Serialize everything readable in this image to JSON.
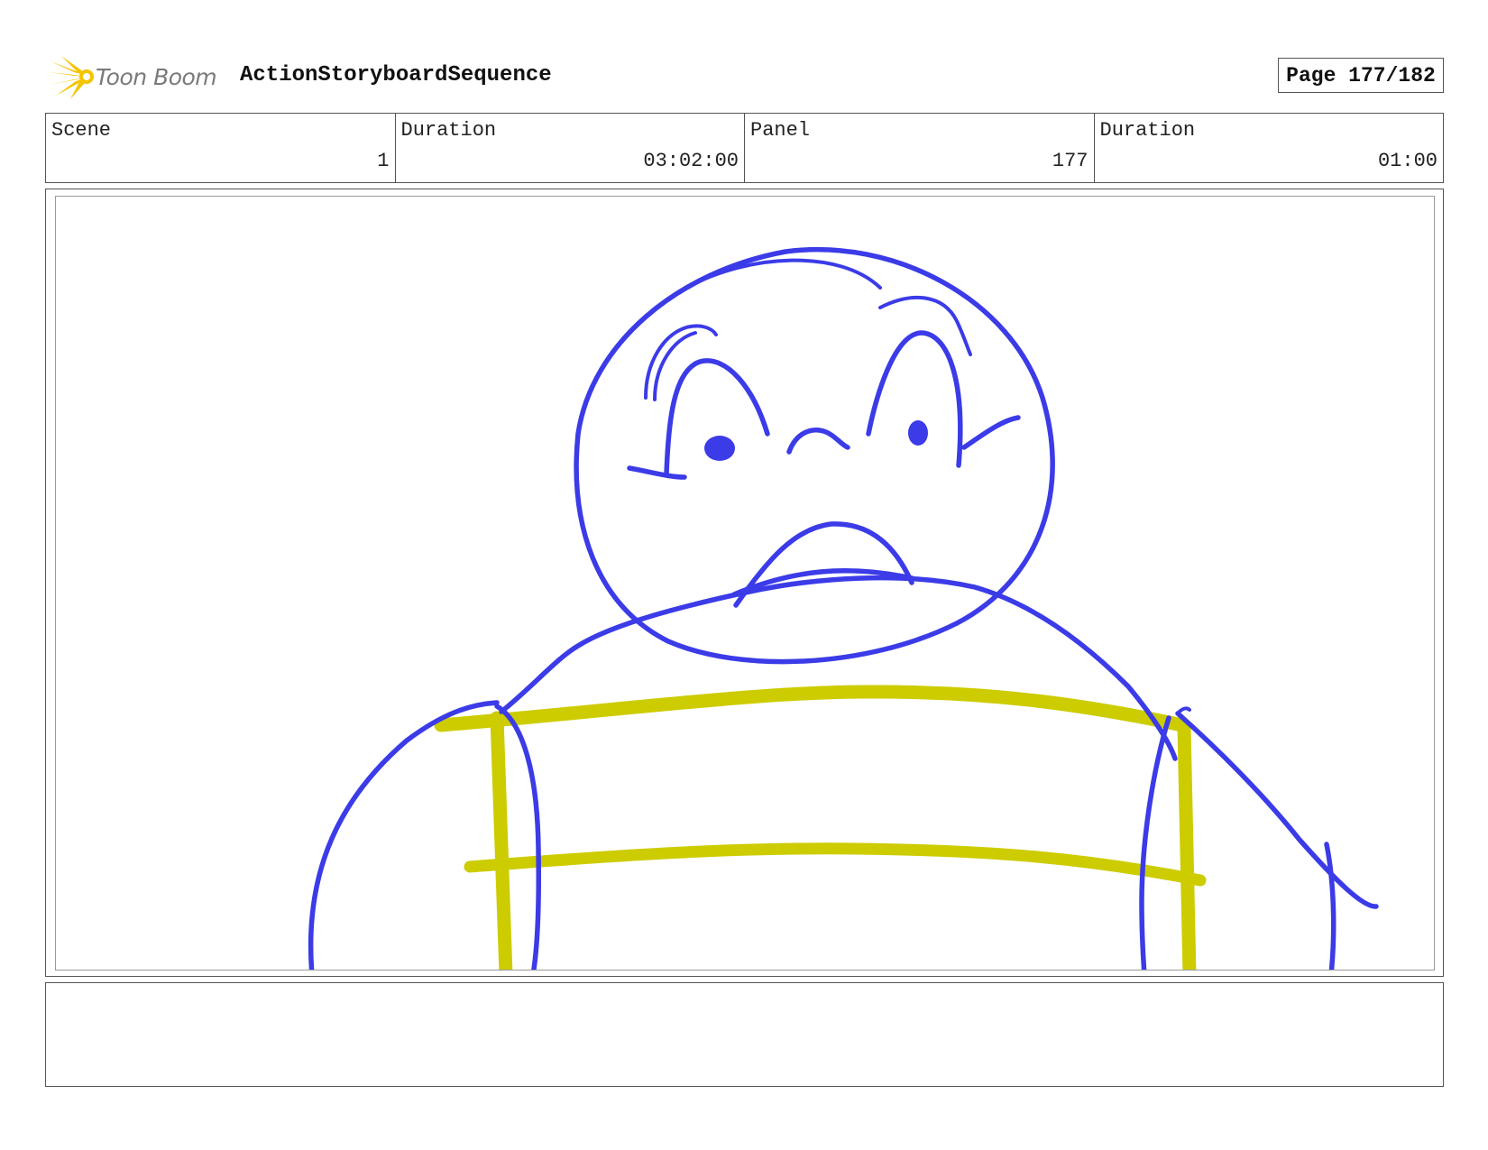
{
  "header": {
    "logo_text": "Toon Boom",
    "title": "ActionStoryboardSequence",
    "page_label": "Page 177/182"
  },
  "info": {
    "scene_label": "Scene",
    "scene_value": "1",
    "duration_label": "Duration",
    "duration_value": "03:02:00",
    "panel_label": "Panel",
    "panel_value": "177",
    "panel_duration_label": "Duration",
    "panel_duration_value": "01:00"
  },
  "colors": {
    "sketch_blue": "#3b3be8",
    "sketch_yellow": "#cccc00",
    "logo_yellow": "#f5c400",
    "border": "#555555"
  },
  "notes": {
    "text": ""
  }
}
